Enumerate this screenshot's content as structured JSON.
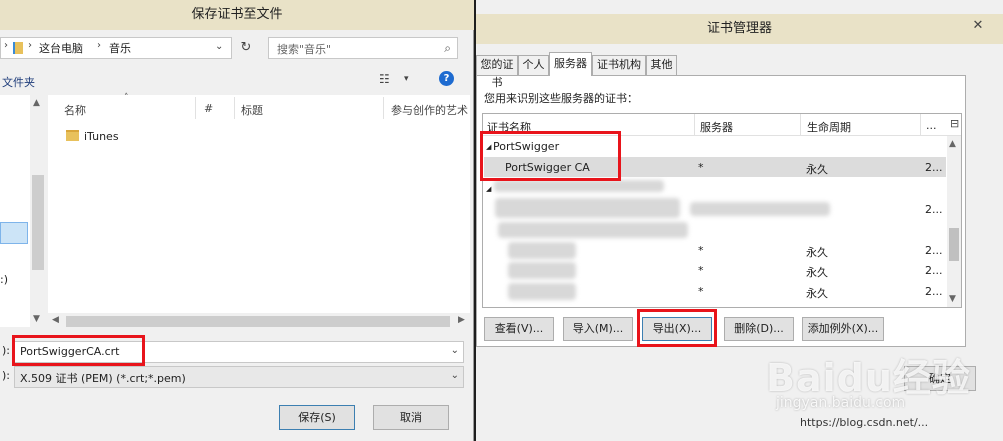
{
  "save_dialog": {
    "title": "保存证书至文件",
    "close_glyph": "✕",
    "address": {
      "crumb_1": "这台电脑",
      "crumb_2": "音乐",
      "chevron": "›",
      "dropdown": "⌄"
    },
    "refresh_glyph": "↻",
    "search_placeholder": "搜索\"音乐\"",
    "search_glyph": "⌕",
    "new_folder": "文件夹",
    "view_glyph": "☷",
    "view_dropdown": "▾",
    "help_glyph": "?",
    "nav_fragment": ":)",
    "columns": {
      "name": "名称",
      "number": "#",
      "title": "标题",
      "artists": "参与创作的艺术"
    },
    "sort_arrow": "˄",
    "items": [
      {
        "name": "iTunes"
      }
    ],
    "filename_label": "):",
    "filename_value": "PortSwiggerCA.crt",
    "filetype_label": "):",
    "filetype_value": "X.509 证书 (PEM) (*.crt;*.pem)",
    "dropdown_glyph": "⌄",
    "save_button": "保存(S)",
    "cancel_button": "取消",
    "scroll": {
      "up": "▲",
      "down": "▼",
      "left": "◀",
      "right": "▶"
    }
  },
  "cert_manager": {
    "title": "证书管理器",
    "close_glyph": "✕",
    "tabs": [
      "您的证书",
      "个人",
      "服务器",
      "证书机构",
      "其他"
    ],
    "active_tab": "服务器",
    "description": "您用来识别这些服务器的证书：",
    "columns": {
      "name": "证书名称",
      "server": "服务器",
      "lifetime": "生命周期",
      "more": "...",
      "picker": "⊟"
    },
    "group": "PortSwigger",
    "tree_arrow": "◢",
    "rows": [
      {
        "name": "PortSwigger CA",
        "server": "*",
        "lifetime": "永久",
        "more": "2..."
      },
      {
        "name": "",
        "server": "",
        "lifetime": "",
        "more": "2..."
      },
      {
        "name": "",
        "server": "*",
        "lifetime": "永久",
        "more": "2..."
      },
      {
        "name": "",
        "server": "*",
        "lifetime": "永久",
        "more": "2..."
      },
      {
        "name": "",
        "server": "*",
        "lifetime": "永久",
        "more": "2..."
      }
    ],
    "buttons": {
      "view": "查看(V)...",
      "import": "导入(M)...",
      "export": "导出(X)...",
      "delete": "删除(D)...",
      "add_exception": "添加例外(X)..."
    },
    "ok_button": "确定",
    "scroll": {
      "up": "▲",
      "down": "▼"
    }
  },
  "watermark": {
    "main": "Baidu经验",
    "sub": "jingyan.baidu.com",
    "blog": "https://blog.csdn.net/..."
  },
  "colors": {
    "highlight": "#e8141b",
    "title_bar": "#e9e2c7",
    "close_red": "#c75050",
    "selection": "#cce4f7"
  }
}
